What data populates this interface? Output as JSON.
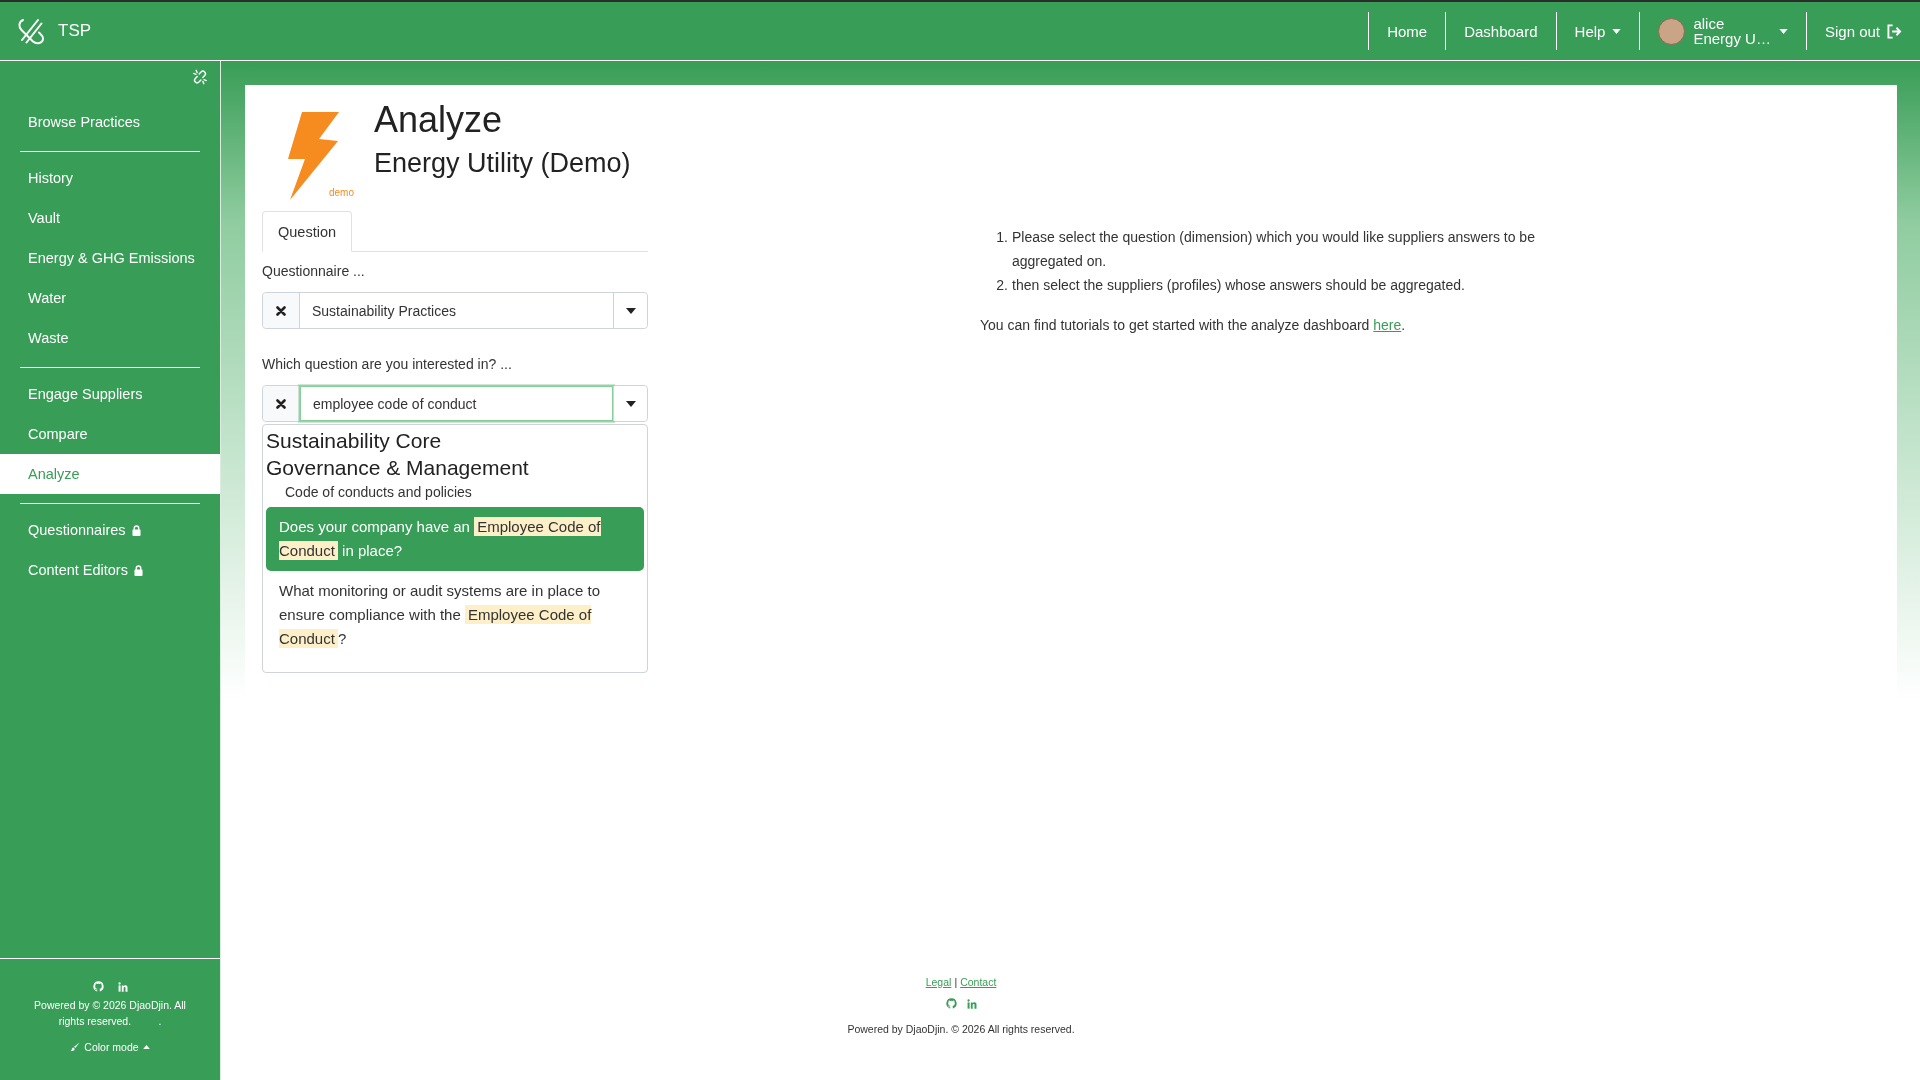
{
  "navbar": {
    "brand": "TSP",
    "links": [
      {
        "label": "Home",
        "kind": "link"
      },
      {
        "label": "Dashboard",
        "kind": "link"
      },
      {
        "label": "Help",
        "kind": "dropdown"
      }
    ],
    "user": {
      "name": "alice",
      "organization": "Energy U…"
    },
    "sign_out": "Sign out"
  },
  "sidebar": {
    "sections": [
      {
        "items": [
          {
            "label": "Browse Practices",
            "selected": false,
            "locked": false
          }
        ]
      },
      {
        "items": [
          {
            "label": "History",
            "selected": false,
            "locked": false
          },
          {
            "label": "Vault",
            "selected": false,
            "locked": false
          },
          {
            "label": "Energy & GHG Emissions",
            "selected": false,
            "locked": false
          },
          {
            "label": "Water",
            "selected": false,
            "locked": false
          },
          {
            "label": "Waste",
            "selected": false,
            "locked": false
          }
        ]
      },
      {
        "items": [
          {
            "label": "Engage Suppliers",
            "selected": false,
            "locked": false
          },
          {
            "label": "Compare",
            "selected": false,
            "locked": false
          },
          {
            "label": "Analyze",
            "selected": true,
            "locked": false
          }
        ]
      },
      {
        "items": [
          {
            "label": "Questionnaires",
            "selected": false,
            "locked": true
          },
          {
            "label": "Content Editors",
            "selected": false,
            "locked": true
          }
        ]
      }
    ],
    "copyright": {
      "text": "Powered by © 2026 DjaoDjin. All rights reserved.",
      "suffix": "."
    },
    "color_mode": "Color mode"
  },
  "page": {
    "title": "Analyze",
    "subtitle": "Energy Utility (Demo)",
    "logo_badge": "demo",
    "tabs": [
      {
        "label": "Question",
        "selected": true
      }
    ],
    "fields": [
      {
        "label": "Questionnaire ...",
        "value": "Sustainability Practices",
        "focused": false
      },
      {
        "label": "Which question are you interested in? ...",
        "value": "employee code of conduct",
        "focused": true,
        "results": {
          "title": "Sustainability Core",
          "section": "Governance & Management",
          "category": "Code of conducts and policies",
          "options": [
            {
              "selected": true,
              "segments": [
                {
                  "text": "Does your company have an ",
                  "highlight": false
                },
                {
                  "text": "Employee Code of Conduct",
                  "highlight": true
                },
                {
                  "text": " in place?",
                  "highlight": false
                }
              ]
            },
            {
              "selected": false,
              "segments": [
                {
                  "text": "What monitoring or audit systems are in place to ensure compliance with the ",
                  "highlight": false
                },
                {
                  "text": "Employee Code of Conduct",
                  "highlight": true
                },
                {
                  "text": "?",
                  "highlight": false
                }
              ]
            }
          ]
        }
      }
    ]
  },
  "instructions": {
    "steps": [
      {
        "number": "1.",
        "text": "Please select the question (dimension) which you would like suppliers answers to be aggregated on."
      },
      {
        "number": "2.",
        "text": "then select the suppliers (profiles) whose answers should be aggregated."
      }
    ],
    "note": {
      "text": "You can find tutorials to get started with the analyze dashboard",
      "link": "here",
      "suffix": "."
    }
  },
  "footer": {
    "links": [
      {
        "label": "Legal"
      },
      {
        "label": "Contact"
      }
    ],
    "separator": "|",
    "copyright": "Powered by DjaoDjin. © 2026 All rights reserved."
  }
}
